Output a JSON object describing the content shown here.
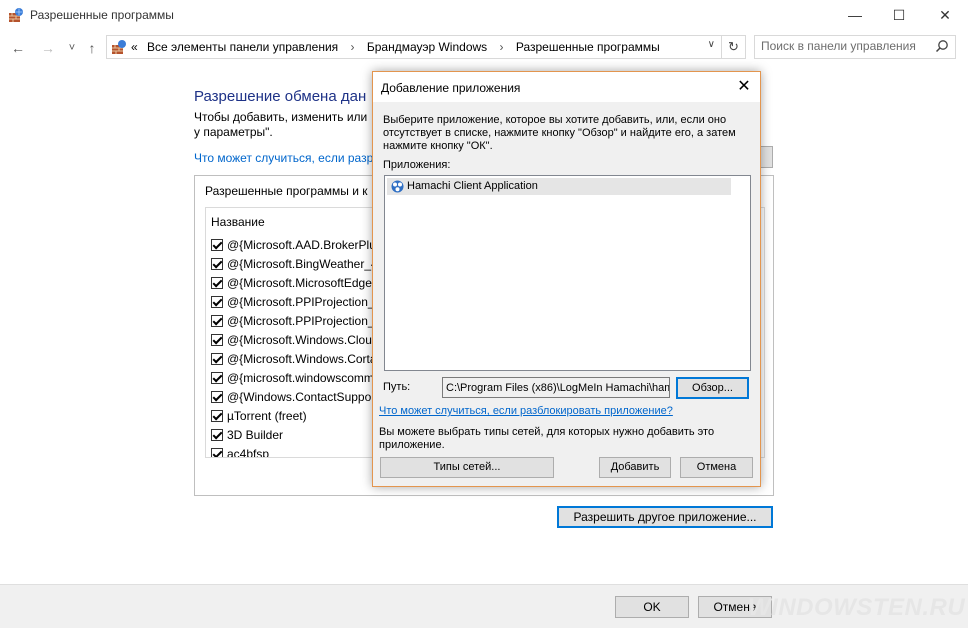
{
  "window": {
    "title": "Разрешенные программы",
    "minimize": "—",
    "maximize": "☐",
    "close": "✕"
  },
  "nav": {
    "back": "←",
    "forward": "→",
    "recent": "˅",
    "up": "↑"
  },
  "address": {
    "overflow": "«",
    "crumbs": [
      "Все элементы панели управления",
      "Брандмауэр Windows",
      "Разрешенные программы"
    ],
    "separator": "›",
    "dropdown": "∨",
    "refresh": "↻"
  },
  "search": {
    "placeholder": "Поиск в панели управления"
  },
  "main": {
    "heading": "Разрешение обмена дан",
    "description": "Чтобы добавить, изменить или у параметры\".",
    "risk_link": "Что может случиться, если разр",
    "group_label": "Разрешенные программы и к",
    "column_name": "Название",
    "programs": [
      "@{Microsoft.AAD.BrokerPlu",
      "@{Microsoft.BingWeather_4",
      "@{Microsoft.MicrosoftEdge",
      "@{Microsoft.PPIProjection_",
      "@{Microsoft.PPIProjection_",
      "@{Microsoft.Windows.Clou",
      "@{Microsoft.Windows.Corta",
      "@{microsoft.windowscomm",
      "@{Windows.ContactSuppor",
      "µTorrent (freet)",
      "3D Builder",
      "ac4bfsp"
    ],
    "allow_other_button": "Разрешить другое приложение..."
  },
  "footer": {
    "ok": "OK",
    "cancel": "Отмена",
    "watermark": "WINDOWSTEN.RU"
  },
  "dialog": {
    "title": "Добавление приложения",
    "close": "✕",
    "instruction": "Выберите приложение, которое вы хотите добавить, или, если оно отсутствует в списке, нажмите кнопку \"Обзор\" и найдите его, а затем нажмите кнопку \"ОК\".",
    "apps_label": "Приложения:",
    "apps": [
      "Hamachi Client Application"
    ],
    "path_label": "Путь:",
    "path_value": "C:\\Program Files (x86)\\LogMeIn Hamachi\\ham",
    "browse": "Обзор...",
    "unblock_link": "Что может случиться, если разблокировать приложение?",
    "network_text": "Вы можете выбрать типы сетей, для которых нужно добавить это приложение.",
    "network_types": "Типы сетей...",
    "add": "Добавить",
    "cancel": "Отмена"
  },
  "colors": {
    "heading": "#1e3287",
    "link": "#0066cc",
    "focus_border": "#0078d7",
    "dialog_border": "#e3954e"
  }
}
